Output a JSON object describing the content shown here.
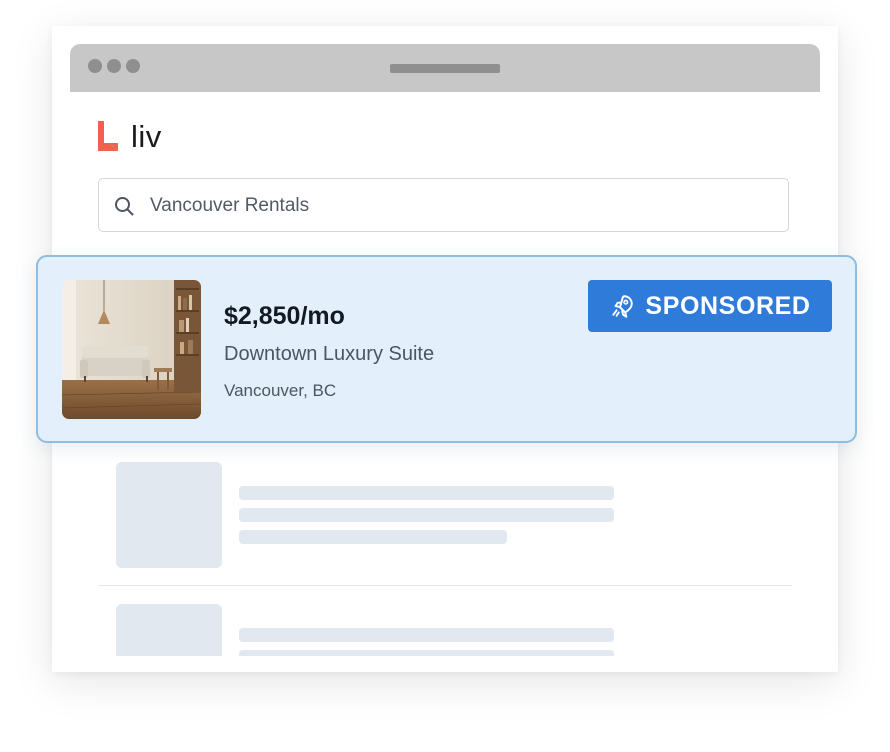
{
  "app": {
    "logo_text": "liv"
  },
  "search": {
    "query": "Vancouver Rentals"
  },
  "sponsored_listing": {
    "price": "$2,850/mo",
    "title": "Downtown Luxury Suite",
    "location": "Vancouver, BC",
    "badge_label": "SPONSORED",
    "badge_icon": "rocket-icon",
    "photo_subject": "living room with sofa, pendant lamp and bookshelf"
  },
  "colors": {
    "logo_accent": "#f0624d",
    "badge_background": "#2f7bd9",
    "card_background": "#e3f0fb",
    "card_border": "#8dbde0",
    "skeleton": "#e2e8f0"
  }
}
